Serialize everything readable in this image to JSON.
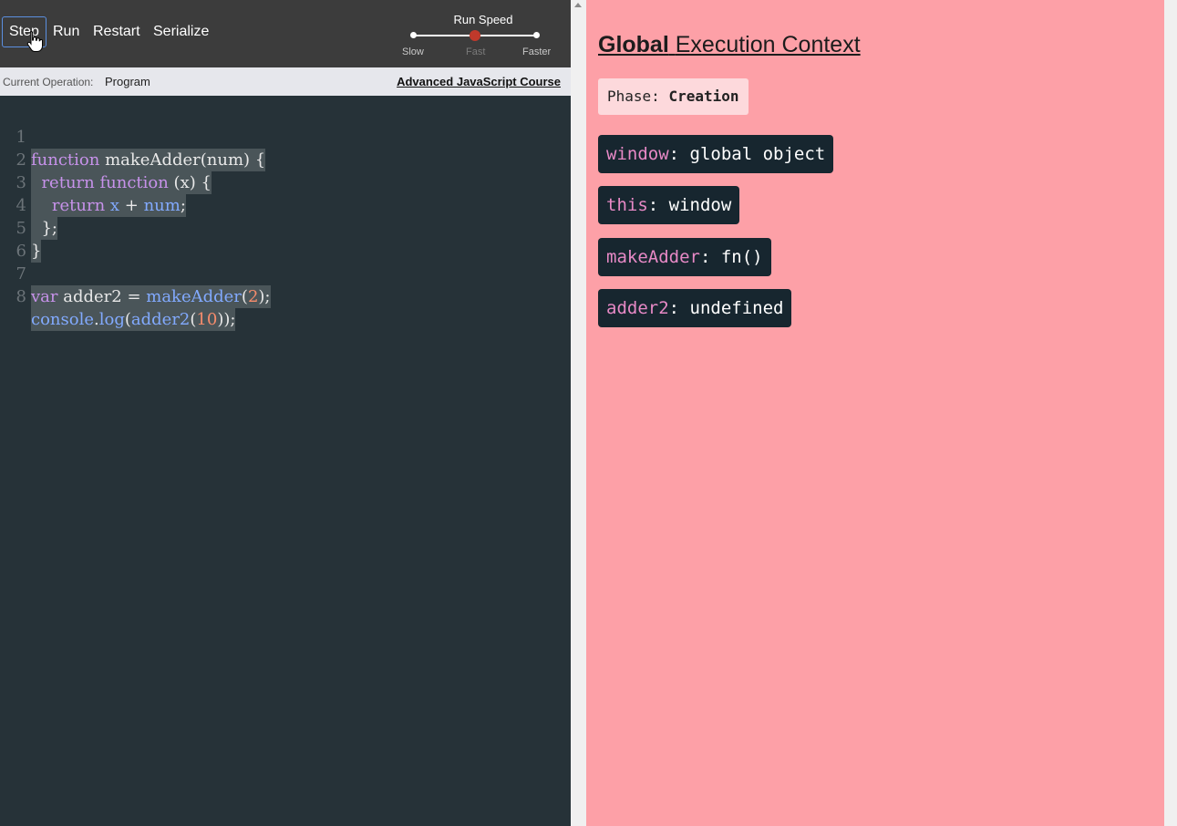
{
  "toolbar": {
    "buttons": [
      "Step",
      "Run",
      "Restart",
      "Serialize"
    ],
    "speed": {
      "title": "Run Speed",
      "labels": [
        "Slow",
        "Fast",
        "Faster"
      ],
      "selected": "Fast"
    }
  },
  "status": {
    "label": "Current Operation:",
    "value": "Program",
    "link": "Advanced JavaScript Course"
  },
  "code": {
    "line_numbers": [
      "1",
      "2",
      "3",
      "4",
      "5",
      "6",
      "7",
      "8"
    ],
    "lines": [
      "function makeAdder(num) {",
      "  return function (x) {",
      "    return x + num;",
      "  };",
      "}",
      "",
      "var adder2 = makeAdder(2);",
      "console.log(adder2(10));"
    ]
  },
  "context": {
    "title_bold": "Global",
    "title_rest": "Execution Context",
    "phase_label": "Phase:",
    "phase_value": "Creation",
    "variables": [
      {
        "name": "window",
        "value": ": global object"
      },
      {
        "name": "this",
        "value": ": window"
      },
      {
        "name": "makeAdder",
        "value": ": fn()"
      },
      {
        "name": "adder2",
        "value": ": undefined"
      }
    ]
  },
  "colors": {
    "editor_bg": "#263238",
    "toolbar_bg": "#3c3c3c",
    "context_bg": "#fda0a7",
    "variable_bg": "#17262f",
    "variable_name": "#e789c6",
    "speed_thumb": "#c0392b"
  }
}
